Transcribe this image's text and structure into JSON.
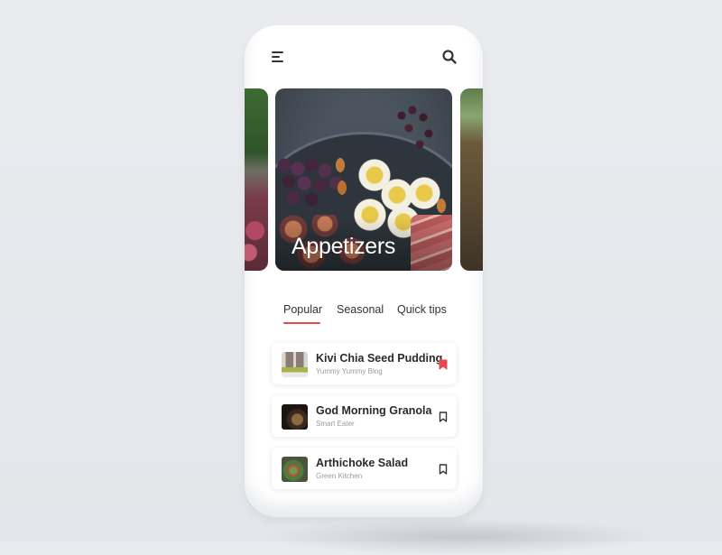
{
  "header": {
    "menu_icon": "hamburger-menu-icon",
    "search_icon": "search-icon"
  },
  "carousel": {
    "cards": [
      {
        "title": "",
        "position": "previous"
      },
      {
        "title": "Appetizers",
        "position": "current"
      },
      {
        "title": "",
        "position": "next"
      }
    ]
  },
  "tabs": [
    {
      "label": "Popular",
      "active": true
    },
    {
      "label": "Seasonal",
      "active": false
    },
    {
      "label": "Quick tips",
      "active": false
    }
  ],
  "recipes": [
    {
      "title": "Kivi Chia Seed Pudding",
      "source": "Yummy Yummy Blog",
      "bookmarked": true
    },
    {
      "title": "God Morning Granola",
      "source": "Smart Eater",
      "bookmarked": false
    },
    {
      "title": "Arthichoke Salad",
      "source": "Green Kitchen",
      "bookmarked": false
    }
  ],
  "colors": {
    "accent": "#e5484d",
    "text_primary": "#2a2a2a",
    "text_secondary": "#9a9a9a",
    "background": "#e6e8ec"
  }
}
